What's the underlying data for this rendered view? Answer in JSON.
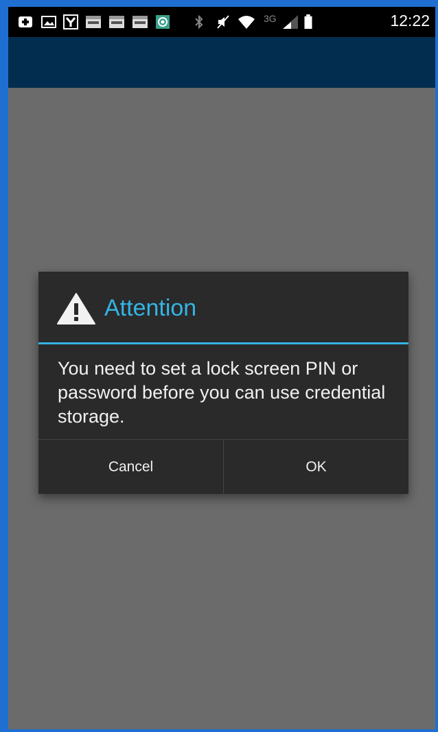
{
  "status_bar": {
    "time": "12:22",
    "network_type": "3G",
    "icons": [
      "add-notification-icon",
      "image-notification-icon",
      "y-app-icon",
      "ebay-icon",
      "ebay-icon",
      "ebay-icon",
      "at-sign-icon",
      "bluetooth-icon",
      "mute-icon",
      "wifi-icon",
      "signal-icon",
      "battery-icon"
    ]
  },
  "dialog": {
    "title": "Attention",
    "icon": "warning-icon",
    "message": "You need to set a lock screen PIN or password before you can use credential storage.",
    "cancel_label": "Cancel",
    "ok_label": "OK"
  },
  "colors": {
    "accent": "#33b5e5",
    "action_bar": "#022d4f",
    "dim_background": "#6b6b6b",
    "dialog_background": "#2a2a2a"
  }
}
